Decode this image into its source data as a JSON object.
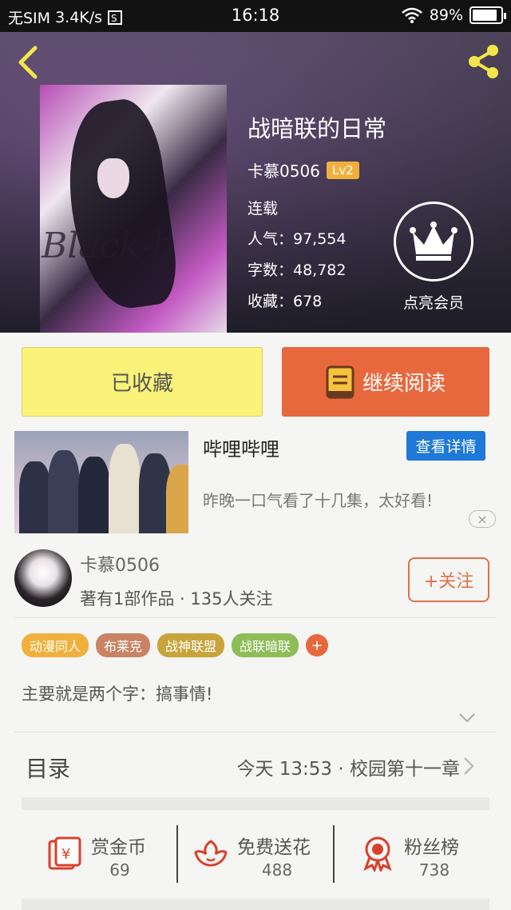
{
  "status_bar": {
    "carrier": "无SIM",
    "speed": "3.4K/s",
    "time": "16:18",
    "battery": "89%",
    "battery_level": 0.89
  },
  "book": {
    "title": "战暗联的日常",
    "author": "卡慕0506",
    "level": "Lv2",
    "status": "连载",
    "popularity": "人气：97,554",
    "words": "字数：48,782",
    "favorites": "收藏：678",
    "cover_text": "Black-b",
    "vip_label": "点亮会员"
  },
  "actions": {
    "favorited_label": "已收藏",
    "continue_label": "继续阅读"
  },
  "ad": {
    "title": "哔哩哔哩",
    "detail_label": "查看详情",
    "description": "昨晚一口气看了十几集，太好看!",
    "close": "×"
  },
  "author": {
    "name": "卡慕0506",
    "meta": "著有1部作品 · 135人关注",
    "follow_label": "+关注"
  },
  "tags": [
    {
      "label": "动漫同人",
      "color": "#f0b13c"
    },
    {
      "label": "布莱克",
      "color": "#c98466"
    },
    {
      "label": "战神联盟",
      "color": "#c9a43b"
    },
    {
      "label": "战联暗联",
      "color": "#8ebd57"
    }
  ],
  "tag_add": "+",
  "description": "主要就是两个字：搞事情!",
  "catalog": {
    "label": "目录",
    "latest": "今天 13:53 · 校园第十一章"
  },
  "stats": [
    {
      "label": "赏金币",
      "value": "69",
      "icon": "red-envelope-yen-icon"
    },
    {
      "label": "免费送花",
      "value": "488",
      "icon": "flower-icon"
    },
    {
      "label": "粉丝榜",
      "value": "738",
      "icon": "award-ribbon-icon"
    }
  ],
  "colors": {
    "accent_orange": "#e8683d",
    "fav_yellow": "#fbf27a",
    "ad_blue": "#1e79d8",
    "icon_red": "#d9402c"
  }
}
